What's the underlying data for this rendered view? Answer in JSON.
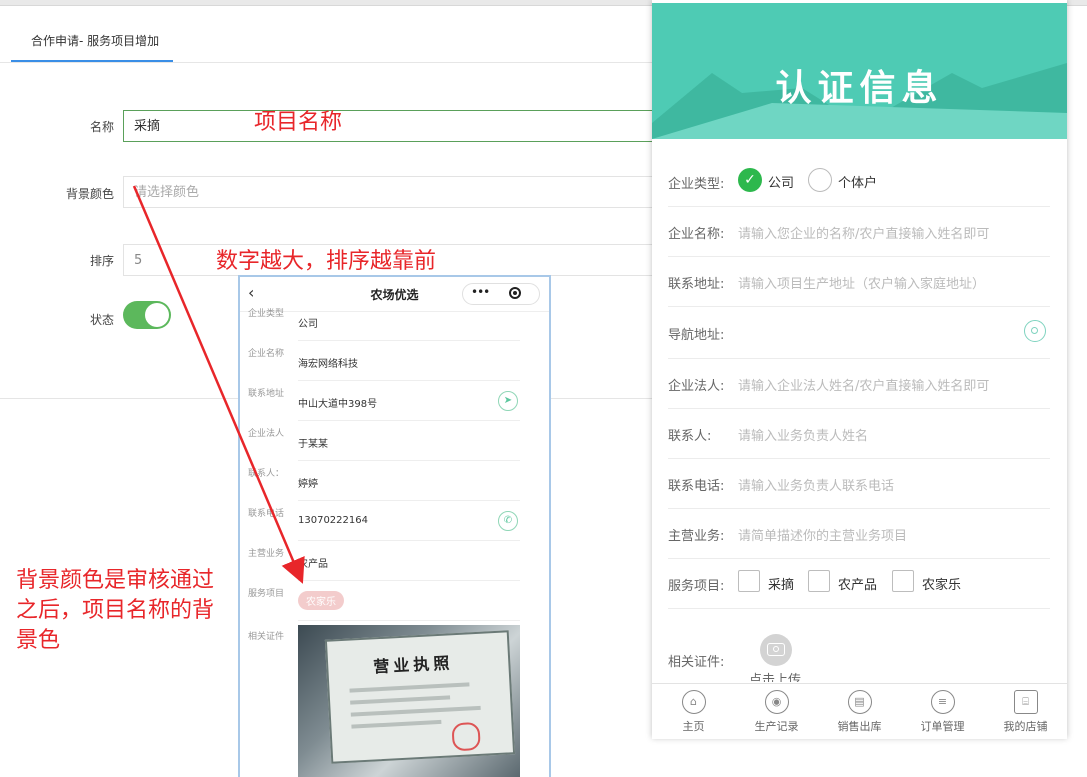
{
  "tab": {
    "active_label": "合作申请- 服务项目增加"
  },
  "form": {
    "name_label": "名称",
    "name_value": "采摘",
    "bgcolor_label": "背景颜色",
    "bgcolor_placeholder": "请选择颜色",
    "sort_label": "排序",
    "sort_value": "5",
    "status_label": "状态",
    "status_on": true
  },
  "annotations": {
    "name_note": "项目名称",
    "sort_note": "数字越大，排序越靠前",
    "bgcolor_note_1": "背景颜色是审核通过",
    "bgcolor_note_2": "之后，项目名称的背",
    "bgcolor_note_3": "景色",
    "arrow_color": "#e8262a"
  },
  "phone": {
    "title": "农场优选",
    "back_icon": "chevron-left-icon",
    "more_icon": "more-dots-icon",
    "record_icon": "target-circle-icon",
    "rows": [
      {
        "label": "企业类型",
        "value": "公司"
      },
      {
        "label": "企业名称",
        "value": "海宏网络科技"
      },
      {
        "label": "联系地址",
        "value": "中山大道中398号"
      },
      {
        "label": "企业法人",
        "value": "于某某"
      },
      {
        "label": "联系人：",
        "value": "婷婷"
      },
      {
        "label": "联系电话",
        "value": "13070222164"
      },
      {
        "label": "主营业务",
        "value": "农产品"
      }
    ],
    "service_label": "服务项目",
    "service_tag": "农家乐",
    "service_tag_color": "#f3cccc",
    "cert_label": "相关证件",
    "license_title": "营业执照"
  },
  "panel": {
    "title": "认证信息",
    "banner_color": "#4ecbb4",
    "type_label": "企业类型:",
    "type_options": [
      "公司",
      "个体户"
    ],
    "type_selected": "公司",
    "rows": [
      {
        "label": "企业名称:",
        "placeholder": "请输入您企业的名称/农户直接输入姓名即可"
      },
      {
        "label": "联系地址:",
        "placeholder": "请输入项目生产地址（农户输入家庭地址）"
      },
      {
        "label": "导航地址:",
        "placeholder": ""
      },
      {
        "label": "企业法人:",
        "placeholder": "请输入企业法人姓名/农户直接输入姓名即可"
      },
      {
        "label": "联系人:",
        "placeholder": "请输入业务负责人姓名"
      },
      {
        "label": "联系电话:",
        "placeholder": "请输入业务负责人联系电话"
      },
      {
        "label": "主营业务:",
        "placeholder": "请简单描述你的主营业务项目"
      }
    ],
    "service_label": "服务项目:",
    "service_options": [
      "采摘",
      "农产品",
      "农家乐"
    ],
    "cert_label": "相关证件:",
    "upload_label": "点击上传",
    "tabbar": [
      {
        "label": "主页",
        "icon": "home-icon"
      },
      {
        "label": "生产记录",
        "icon": "camera-icon"
      },
      {
        "label": "销售出库",
        "icon": "printer-icon"
      },
      {
        "label": "订单管理",
        "icon": "list-icon"
      },
      {
        "label": "我的店铺",
        "icon": "store-icon"
      }
    ]
  }
}
